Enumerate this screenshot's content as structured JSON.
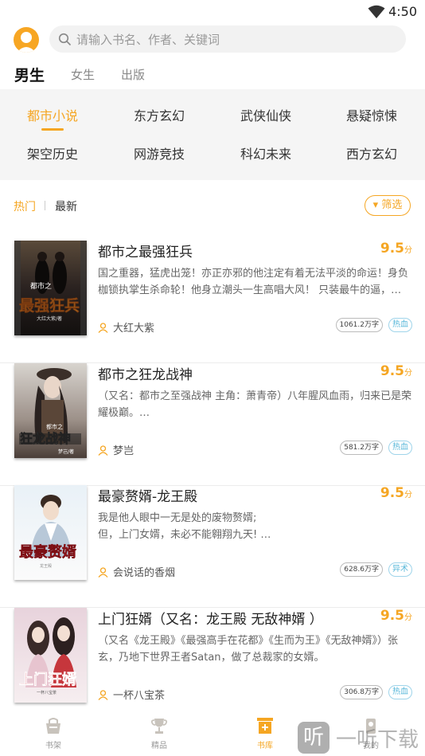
{
  "status_bar": {
    "time": "4:50",
    "wifi_icon": "wifi-icon"
  },
  "search": {
    "placeholder": "请输入书名、作者、关键词",
    "icon": "search-icon"
  },
  "gender_tabs": [
    "男生",
    "女生",
    "出版"
  ],
  "categories": [
    "都市小说",
    "东方玄幻",
    "武侠仙侠",
    "悬疑惊悚",
    "架空历史",
    "网游竞技",
    "科幻未来",
    "西方玄幻"
  ],
  "sort": {
    "hot": "热门",
    "latest": "最新",
    "filter": "▾ 筛选"
  },
  "books": [
    {
      "title": "都市之最强狂兵",
      "score": "9.5",
      "score_unit": "分",
      "desc": "国之重器，猛虎出笼！亦正亦邪的他注定有着无法平淡的命运！身负枷锁执掌生杀命轮！他身立潮头一生高唱大风！ 只装最牛的逼，…",
      "author": "大红大紫",
      "words": "1061.2万字",
      "tag": "热血",
      "cover_title": "最强狂兵",
      "cover_top": "都市之",
      "cover_author": "大红大紫/著"
    },
    {
      "title": "都市之狂龙战神",
      "score": "9.5",
      "score_unit": "分",
      "desc": "（又名：都市之至强战神 主角：萧青帝）八年腥风血雨，归来已是荣耀极巅。…",
      "author": "梦岂",
      "words": "581.2万字",
      "tag": "热血",
      "cover_title": "狂龙战神",
      "cover_top": "都市之",
      "cover_author": "梦岂/著"
    },
    {
      "title": "最豪赘婿-龙王殿",
      "score": "9.5",
      "score_unit": "分",
      "desc": "我是他人眼中一无是处的废物赘婿;\n但，上门女婿，未必不能翱翔九天! …",
      "author": "会说话的香烟",
      "words": "628.6万字",
      "tag": "异术",
      "cover_title": "最豪赘婿",
      "cover_top": "",
      "cover_author": "龙王殿"
    },
    {
      "title": "上门狂婿（又名：龙王殿 无敌神婿 ）",
      "score": "9.5",
      "score_unit": "分",
      "desc": "（又名《龙王殿》《最强高手在花都》《生而为王》《无敌神婿》）张玄，乃地下世界王者Satan，做了总裁家的女婿。",
      "author": "一杯八宝茶",
      "words": "306.8万字",
      "tag": "热血",
      "cover_title": "上门狂婿",
      "cover_top": "",
      "cover_author": "一杯八宝茶"
    }
  ],
  "bottom_nav": [
    {
      "label": "书架",
      "icon": "bookshelf-icon",
      "active": false
    },
    {
      "label": "精品",
      "icon": "trophy-icon",
      "active": false
    },
    {
      "label": "书库",
      "icon": "library-icon",
      "active": true
    },
    {
      "label": "我的",
      "icon": "profile-icon",
      "active": false
    }
  ],
  "watermark": {
    "glyph": "听",
    "text": "一听下载"
  },
  "colors": {
    "accent": "#f5a623",
    "tag_blue": "#59b8da",
    "panel_bg": "#f5f5f5"
  }
}
